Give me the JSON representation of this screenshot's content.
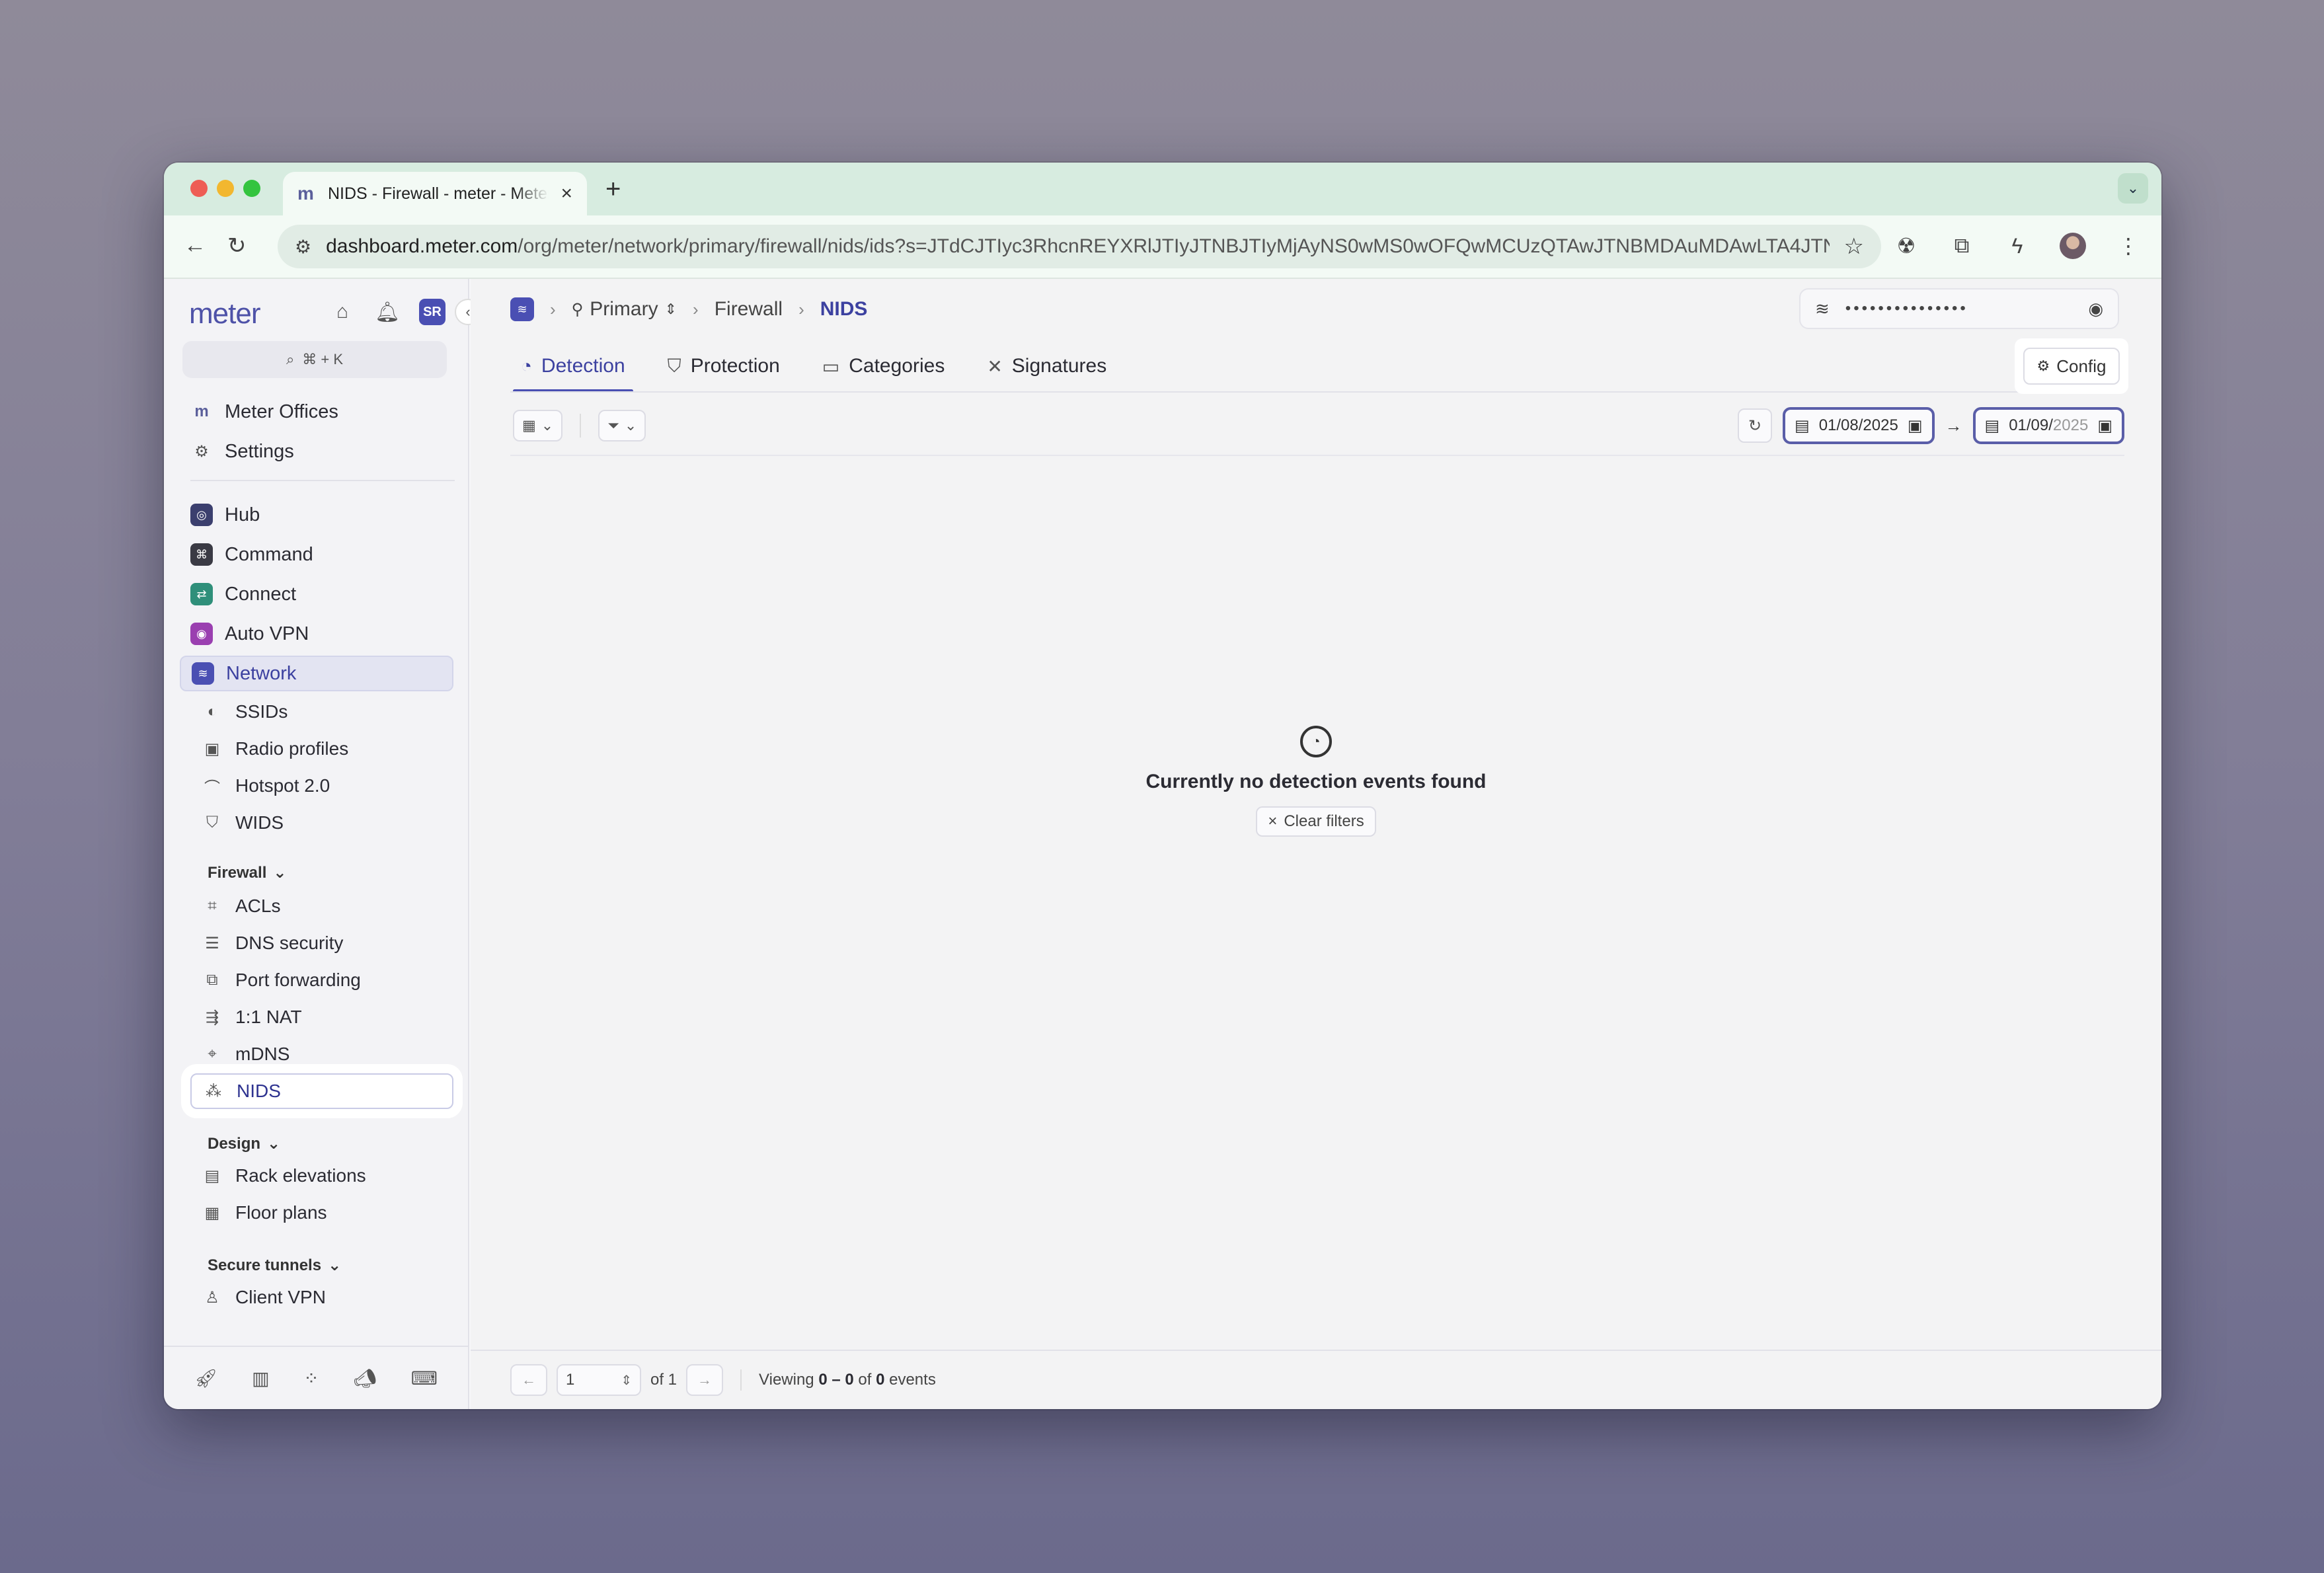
{
  "browser": {
    "tab_title": "NIDS - Firewall - meter - Meter",
    "tab_favicon": "m",
    "url_host": "dashboard.meter.com",
    "url_path": "/org/meter/network/primary/firewall/nids/ids?s=JTdCJTIyc3RhcnREYXRlJTIyJTNBJTIyMjAyNS0wMS0wOFQwMCUzQTAwJTNBMDAuMDAwLTA4JTNB..."
  },
  "sidebar": {
    "logo": "meter",
    "user_initials": "SR",
    "search_shortcut": "⌘ + K",
    "top_items": [
      {
        "label": "Meter Offices"
      },
      {
        "label": "Settings"
      }
    ],
    "apps": [
      {
        "label": "Hub",
        "color": "#3b3f6e"
      },
      {
        "label": "Command",
        "color": "#3a3a44"
      },
      {
        "label": "Connect",
        "color": "#2f8f7a"
      },
      {
        "label": "Auto VPN",
        "color": "#9a3fb0"
      },
      {
        "label": "Network",
        "color": "#4a4fb3"
      }
    ],
    "network_items": [
      {
        "label": "SSIDs"
      },
      {
        "label": "Radio profiles"
      },
      {
        "label": "Hotspot 2.0"
      },
      {
        "label": "WIDS"
      }
    ],
    "firewall_heading": "Firewall",
    "firewall_items": [
      {
        "label": "ACLs"
      },
      {
        "label": "DNS security"
      },
      {
        "label": "Port forwarding"
      },
      {
        "label": "1:1 NAT"
      },
      {
        "label": "mDNS"
      },
      {
        "label": "NIDS"
      }
    ],
    "design_heading": "Design",
    "design_items": [
      {
        "label": "Rack elevations"
      },
      {
        "label": "Floor plans"
      }
    ],
    "tunnels_heading": "Secure tunnels",
    "tunnels_items": [
      {
        "label": "Client VPN"
      }
    ]
  },
  "header": {
    "breadcrumb": {
      "network": "Primary",
      "section": "Firewall",
      "current": "NIDS"
    },
    "wifi_password_masked": "•••••••••••••••"
  },
  "tabs": [
    {
      "label": "Detection"
    },
    {
      "label": "Protection"
    },
    {
      "label": "Categories"
    },
    {
      "label": "Signatures"
    }
  ],
  "config_label": "Config",
  "dates": {
    "start": "01/08/2025",
    "end_month_day": "01/09/",
    "end_year": "2025"
  },
  "empty_state": {
    "message": "Currently no detection events found",
    "clear_filters": "Clear filters"
  },
  "pager": {
    "page": "1",
    "of_label": "of 1",
    "viewing_prefix": "Viewing",
    "range": "0 – 0",
    "of_word": "of",
    "total": "0",
    "suffix": "events"
  }
}
